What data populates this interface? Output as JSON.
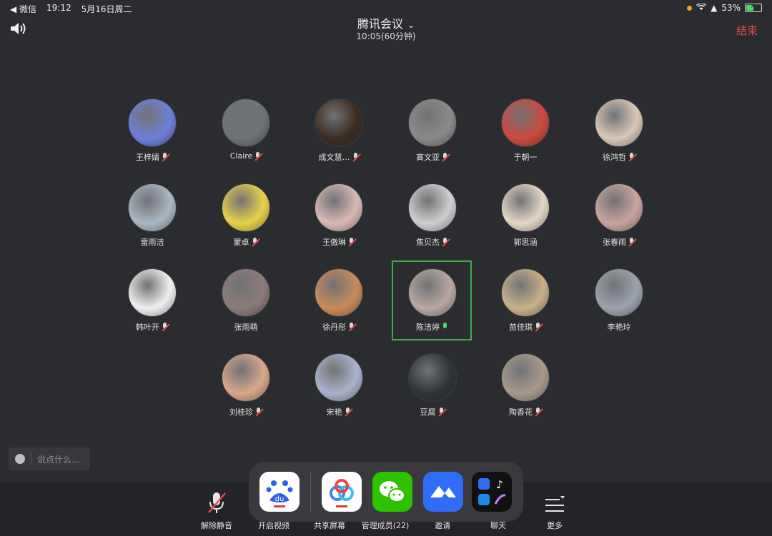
{
  "status_bar": {
    "back_app": "◀ 微信",
    "time": "19:12",
    "date": "5月16日周二",
    "battery": "53%"
  },
  "header": {
    "title": "腾讯会议",
    "duration": "10:05(60分钟)",
    "end_label": "结束"
  },
  "participants": [
    {
      "name": "王梓婧",
      "mic": "muted",
      "color": "#6e7fd9"
    },
    {
      "name": "Claire",
      "mic": "muted",
      "color": "#6f7376"
    },
    {
      "name": "成文慧…",
      "mic": "muted",
      "color": "#3c2c22"
    },
    {
      "name": "高文亚",
      "mic": "muted",
      "color": "#8a8a8a"
    },
    {
      "name": "于朝一",
      "mic": "none",
      "color": "#c94b3d"
    },
    {
      "name": "徐鸿哲",
      "mic": "muted",
      "color": "#d9c7b8"
    },
    {
      "name": "雷雨洁",
      "mic": "none",
      "color": "#a9b7c4"
    },
    {
      "name": "蒙卓",
      "mic": "muted",
      "color": "#e8d24a"
    },
    {
      "name": "王傲琳",
      "mic": "muted",
      "color": "#d9b9b4"
    },
    {
      "name": "焦贝杰",
      "mic": "muted",
      "color": "#cfcfcf"
    },
    {
      "name": "郭思涵",
      "mic": "none",
      "color": "#e4d6c4"
    },
    {
      "name": "张春雨",
      "mic": "muted",
      "color": "#c9a59e"
    },
    {
      "name": "韩叶开",
      "mic": "muted",
      "color": "#f0f0f0"
    },
    {
      "name": "张雨萌",
      "mic": "none",
      "color": "#8c7a7a"
    },
    {
      "name": "徐丹彤",
      "mic": "muted",
      "color": "#c98a59"
    },
    {
      "name": "陈洁婷",
      "mic": "on",
      "color": "#b9a7a2"
    },
    {
      "name": "苗佳琪",
      "mic": "muted",
      "color": "#c9b08a"
    },
    {
      "name": "李艳玲",
      "mic": "none",
      "color": "#9ca3ad"
    },
    {
      "name": "刘桂珍",
      "mic": "muted",
      "color": "#d9a88a"
    },
    {
      "name": "宋艳",
      "mic": "muted",
      "color": "#aab3cc"
    },
    {
      "name": "豆腐",
      "mic": "muted",
      "color": "#2f3437"
    },
    {
      "name": "陶香花",
      "mic": "muted",
      "color": "#a89a8c"
    }
  ],
  "chat": {
    "placeholder": "说点什么..."
  },
  "toolbar": {
    "unmute": "解除静音",
    "video": "开启视频",
    "share": "共享屏幕",
    "members": "管理成员(22)",
    "invite": "邀请",
    "chat": "聊天",
    "more": "更多"
  },
  "dock_apps": [
    "baidu-app-icon",
    "baidu-netdisk-app-icon",
    "wechat-app-icon",
    "lark-app-icon",
    "app-folder-icon"
  ],
  "colors": {
    "end": "#e5484d",
    "speaking_border": "#3bb04a",
    "mic_on": "#4cd964"
  }
}
